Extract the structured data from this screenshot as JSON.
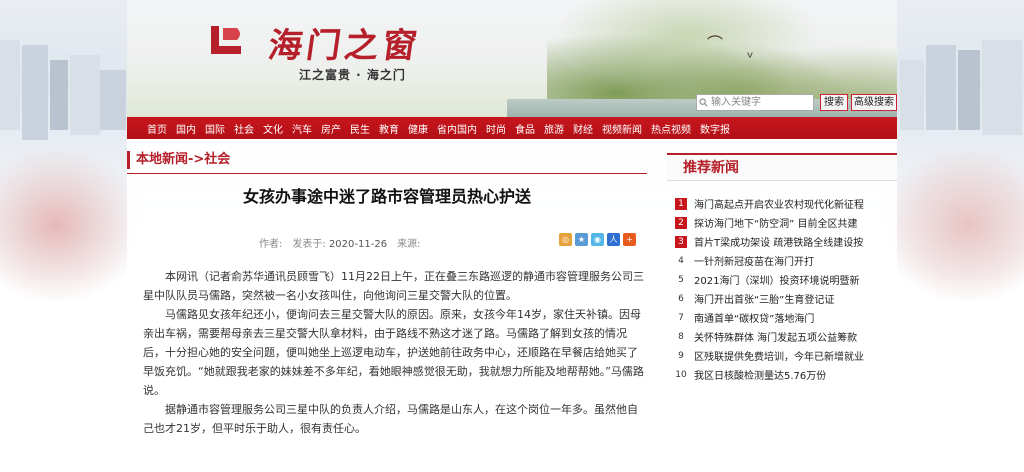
{
  "header": {
    "logo_text": "海门之窗",
    "slogan": "江之富贵 · 海之门"
  },
  "search": {
    "placeholder": "输入关键字",
    "search_label": "搜索",
    "advanced_label": "高级搜索"
  },
  "nav": [
    "首页",
    "国内",
    "国际",
    "社会",
    "文化",
    "汽车",
    "房产",
    "民生",
    "教育",
    "健康",
    "省内国内",
    "时尚",
    "食品",
    "旅游",
    "财经",
    "视频新闻",
    "热点视频",
    "数字报"
  ],
  "breadcrumb": "本地新闻->社会",
  "article": {
    "title": "女孩办事途中迷了路市容管理员热心护送",
    "author_label": "作者:",
    "date_label": "发表于:",
    "date": "2020-11-26",
    "source_label": "来源:",
    "paragraphs": [
      "本网讯（记者俞苏华通讯员顾雪飞）11月22日上午，正在叠三东路巡逻的静通市容管理服务公司三星中队队员马儒路，突然被一名小女孩叫住，向他询问三星交警大队的位置。",
      "马儒路见女孩年纪还小，便询问去三星交警大队的原因。原来，女孩今年14岁，家住天补镇。因母亲出车祸，需要帮母亲去三星交警大队拿材料，由于路线不熟这才迷了路。马儒路了解到女孩的情况后，十分担心她的安全问题，便叫她坐上巡逻电动车，护送她前往政务中心，还顺路在早餐店给她买了早饭充饥。“她就跟我老家的妹妹差不多年纪，看她眼神感觉很无助，我就想力所能及地帮帮她。”马儒路说。",
      "据静通市容管理服务公司三星中队的负责人介绍，马儒路是山东人，在这个岗位一年多。虽然他自己也才21岁，但平时乐于助人，很有责任心。"
    ]
  },
  "sidebar": {
    "title": "推荐新闻",
    "items": [
      {
        "num": "1",
        "text": "海门高起点开启农业农村现代化新征程"
      },
      {
        "num": "2",
        "text": "探访海门地下“防空洞” 目前全区共建"
      },
      {
        "num": "3",
        "text": "首片T梁成功架设 疏港铁路全线建设按"
      },
      {
        "num": "4",
        "text": "一针剂新冠疫苗在海门开打"
      },
      {
        "num": "5",
        "text": "2021海门（深圳）投资环境说明暨新"
      },
      {
        "num": "6",
        "text": "海门开出首张“三胎”生育登记证"
      },
      {
        "num": "7",
        "text": "南通首单“碳权贷”落地海门"
      },
      {
        "num": "8",
        "text": "关怀特殊群体 海门发起五项公益筹款"
      },
      {
        "num": "9",
        "text": "区残联提供免费培训，今年已新增就业"
      },
      {
        "num": "10",
        "text": "我区日核酸检测量达5.76万份"
      }
    ]
  },
  "colors": {
    "brand_red": "#b5202a",
    "nav_red": "#c8161d"
  }
}
